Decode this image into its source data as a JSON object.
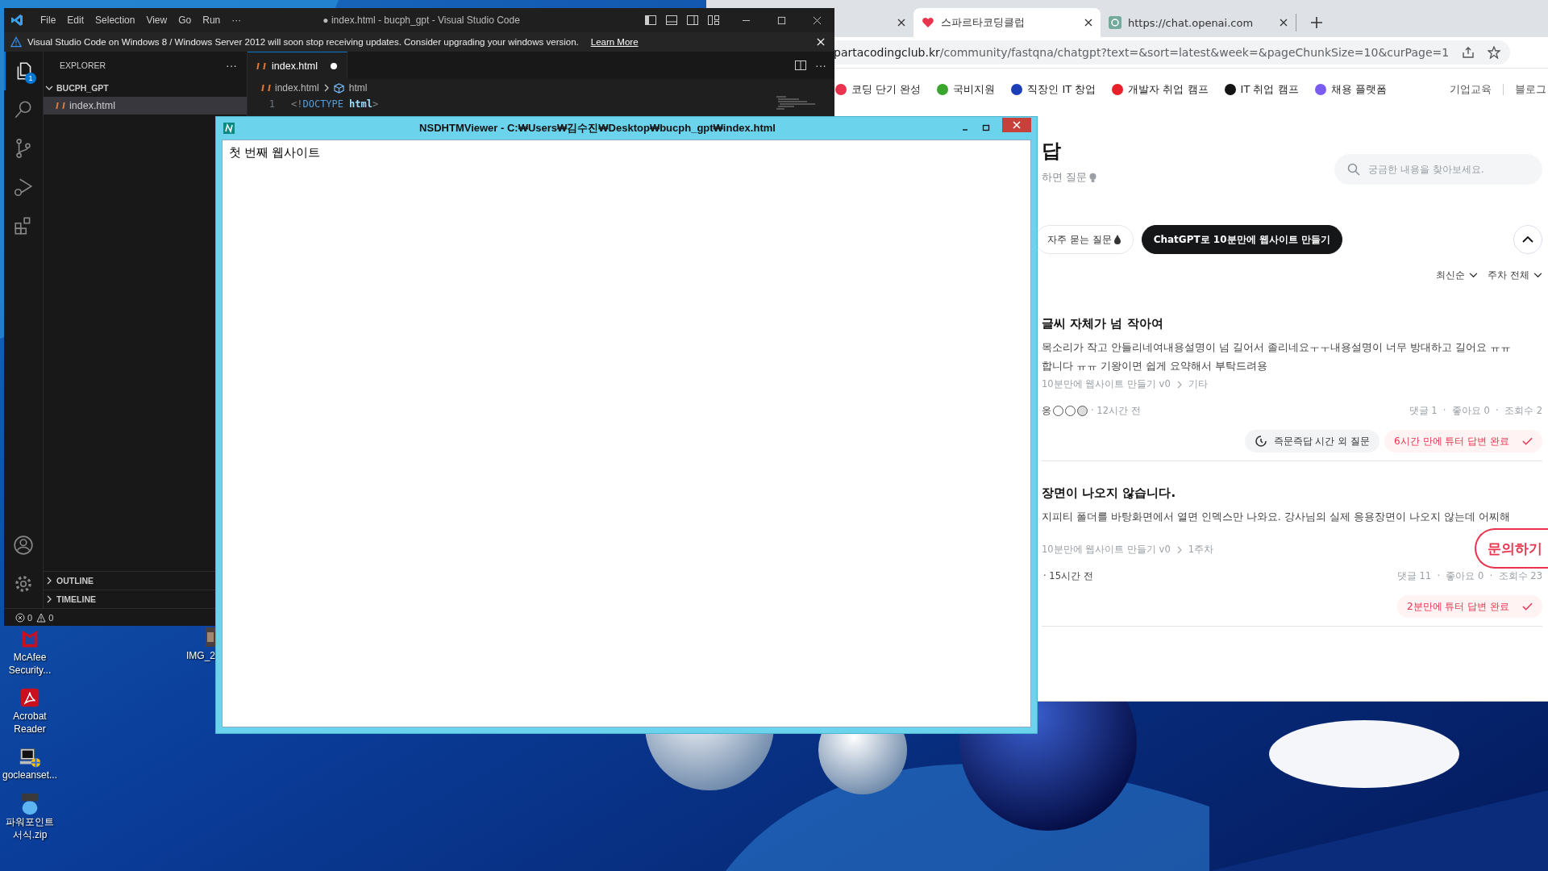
{
  "desktop": {
    "icons": [
      {
        "label": "McAfee Security...",
        "kind": "mcafee"
      },
      {
        "label": "Acrobat Reader",
        "kind": "acrobat"
      },
      {
        "label": "gocleanset...",
        "kind": "setup"
      },
      {
        "label": "파워포인트 서식.zip",
        "kind": "zip"
      }
    ],
    "side_icon": {
      "label": "IMG_2"
    }
  },
  "vscode": {
    "menu": [
      "File",
      "Edit",
      "Selection",
      "View",
      "Go",
      "Run",
      "···"
    ],
    "title": "● index.html - bucph_gpt - Visual Studio Code",
    "notification": {
      "message": "Visual Studio Code on Windows 8 / Windows Server 2012 will soon stop receiving updates. Consider upgrading your windows version.",
      "link": "Learn More"
    },
    "activity": [
      {
        "kind": "explorer",
        "selected": true,
        "badge": "1"
      },
      {
        "kind": "search",
        "selected": false
      },
      {
        "kind": "scm",
        "selected": false
      },
      {
        "kind": "debug",
        "selected": false
      },
      {
        "kind": "extensions",
        "selected": false
      }
    ],
    "explorer": {
      "title": "EXPLORER",
      "more": "···",
      "folder": {
        "name": "BUCPH_GPT",
        "expanded": true,
        "files": [
          {
            "name": "index.html",
            "selected": true
          }
        ]
      },
      "sections": [
        {
          "name": "OUTLINE",
          "expanded": false
        },
        {
          "name": "TIMELINE",
          "expanded": false
        }
      ]
    },
    "editor_tabs": [
      {
        "name": "index.html",
        "modified": true,
        "selected": true
      }
    ],
    "breadcrumb": [
      "index.html",
      "html"
    ],
    "code": [
      {
        "number": "1",
        "tokens": [
          {
            "kind": "punct",
            "text": "<!"
          },
          {
            "kind": "keyword",
            "text": "DOCTYPE"
          },
          {
            "kind": "name",
            "text": "html"
          },
          {
            "kind": "punct",
            "text": ">"
          }
        ]
      }
    ],
    "status": {
      "errors": "0",
      "warnings": "0"
    }
  },
  "viewer": {
    "title": "NSDHTMViewer - C:₩Users₩김수진₩Desktop₩bucph_gpt₩index.html",
    "content": "첫 번째 웹사이트"
  },
  "browser": {
    "tabs": [
      {
        "selected": false
      },
      {
        "title": "스파르타코딩클럽",
        "kind": "sparta",
        "selected": true
      },
      {
        "title": "https://chat.openai.com",
        "kind": "openai",
        "selected": false
      }
    ],
    "url_domain": "partacodingclub.kr",
    "url_path": "/community/fastqna/chatgpt?text=&sort=latest&week=&pageChunkSize=10&curPage=1",
    "nav": [
      {
        "label": "코딩 단기 완성",
        "color": "#e8344e"
      },
      {
        "label": "국비지원",
        "color": "#3aa62e"
      },
      {
        "label": "직장인 IT 창업",
        "color": "#1c3fb8"
      },
      {
        "label": "개발자 취업 캠프",
        "color": "#e8202a"
      },
      {
        "label": "IT 취업 캠프",
        "color": "#141414"
      },
      {
        "label": "채용 플랫폼",
        "color": "#7a5cf0"
      }
    ],
    "nav_right": [
      "기업교육",
      "블로그"
    ],
    "page": {
      "title": "답",
      "subtitle": "하면 질문",
      "search_placeholder": "궁금한 내용을 찾아보세요.",
      "chips": [
        {
          "label": "자주 묻는 질문",
          "selected": false
        },
        {
          "label": "ChatGPT로 10분만에 웹사이트 만들기",
          "selected": true
        }
      ],
      "sort": [
        "최신순",
        "주차 전체"
      ],
      "posts": [
        {
          "title": "글씨 자체가 넘 작아여",
          "body": [
            "목소리가 작고 안들리네여내용설명이 넘 길어서 졸리네요ㅜㅜ내용설명이 너무 방대하고 길어요 ㅠㅠ",
            "합니다 ㅠㅠ 기왕이면 쉽게 요약해서 부탁드려용"
          ],
          "crumb": [
            "10분만에 웹사이트 만들기 v0",
            "기타"
          ],
          "author": "옹",
          "author_icons": [
            {
              "kind": "face"
            },
            {
              "kind": "face"
            },
            {
              "kind": "dog"
            }
          ],
          "time": "· 12시간 전",
          "stats": "댓글 1  ·  좋아요 0  ·  조회수 2",
          "badges": [
            {
              "kind": "outside",
              "label": "즉문즉답 시간 외 질문"
            },
            {
              "kind": "answered",
              "label": "6시간 만에 튜터 답변 완료"
            }
          ]
        },
        {
          "title": "장면이 나오지 않습니다.",
          "body": [
            "지피티 폴더를 바탕화면에서 열면 인덱스만 나와요. 강사님의 실제 응용장면이 나오지 않는데 어찌해"
          ],
          "crumb": [
            "10분만에 웹사이트 만들기 v0",
            "1주차"
          ],
          "time": "· 15시간 전",
          "stats": "댓글 11  ·  좋아요 0  ·  조회수 23",
          "badges": [
            {
              "kind": "answered",
              "label": "2분만에 튜터 답변 완료"
            }
          ]
        }
      ],
      "ask_button": "문의하기"
    }
  }
}
